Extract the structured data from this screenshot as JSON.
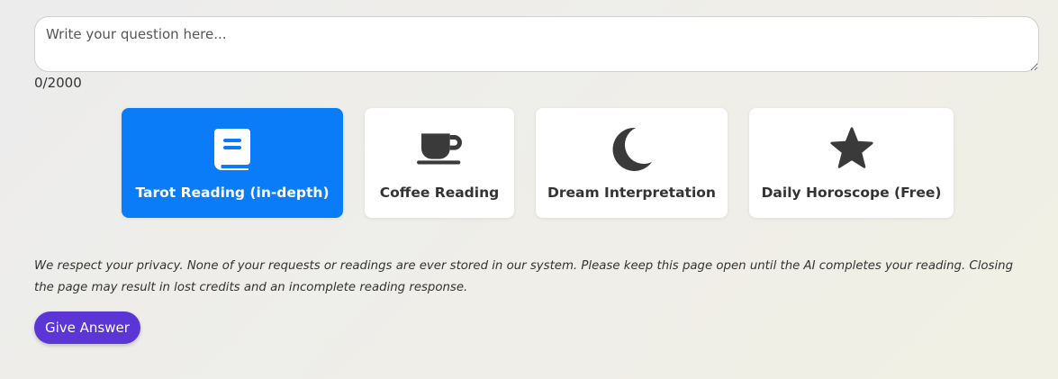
{
  "question": {
    "placeholder": "Write your question here...",
    "value": "",
    "counter": "0/2000"
  },
  "reading_options": [
    {
      "label": "Tarot Reading (in-depth)",
      "icon": "book-icon",
      "selected": true
    },
    {
      "label": "Coffee Reading",
      "icon": "coffee-cup-icon",
      "selected": false
    },
    {
      "label": "Dream Interpretation",
      "icon": "moon-icon",
      "selected": false
    },
    {
      "label": "Daily Horoscope (Free)",
      "icon": "star-icon",
      "selected": false
    }
  ],
  "privacy_notice": "We respect your privacy. None of your requests or readings are ever stored in our system. Please keep this page open until the AI completes your reading. Closing the page may result in lost credits and an incomplete reading response.",
  "submit_label": "Give Answer",
  "colors": {
    "selected_card": "#0a7cf7",
    "submit_button": "#5b35d6",
    "icon": "#3a3a3a"
  }
}
